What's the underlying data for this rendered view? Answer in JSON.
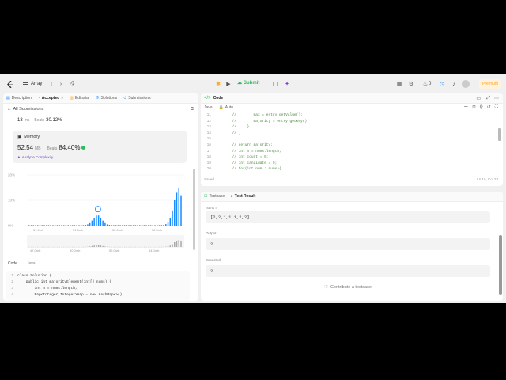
{
  "topbar": {
    "list_label": "Array",
    "submit_label": "Submit",
    "fire_count": "0",
    "premium_label": "Premium"
  },
  "left": {
    "tabs": [
      {
        "label": "Description"
      },
      {
        "label": "Accepted"
      },
      {
        "label": "Editorial"
      },
      {
        "label": "Solutions"
      },
      {
        "label": "Submissions"
      }
    ],
    "all_submissions": "All Submissions",
    "runtime_value": "13",
    "runtime_unit": "ms",
    "runtime_beats_label": "Beats",
    "runtime_beats": "30.12%",
    "memory_title": "Memory",
    "memory_value": "52.54",
    "memory_unit": "MB",
    "memory_beats_label": "Beats",
    "memory_beats": "84.40%",
    "analyze_label": "Analyze Complexity",
    "code_label": "Code",
    "lang_label": "Java",
    "code_lines": [
      {
        "n": "1",
        "t": "class Solution {"
      },
      {
        "n": "2",
        "t": "    public int majorityElement(int[] nums) {"
      },
      {
        "n": "3",
        "t": "        int n = nums.length;"
      },
      {
        "n": "4",
        "t": "        Map<Integer,Integer>map = new HashMap<>();"
      }
    ]
  },
  "chart_data": {
    "type": "bar",
    "ylabels": [
      "20%",
      "10%",
      "0%"
    ],
    "ylim": [
      0,
      20
    ],
    "xlabels": [
      "51.0mb",
      "51.5mb",
      "52.0mb",
      "52.5mb"
    ],
    "mini_xlabels": [
      "47.0mb",
      "50.0mb",
      "52.0mb",
      "54.0mb"
    ],
    "values": [
      0.2,
      0.2,
      0.2,
      0.2,
      0.2,
      0.2,
      0.2,
      0.2,
      0.2,
      0.2,
      0.2,
      0.2,
      0.2,
      0.2,
      0.2,
      0.2,
      0.2,
      0.2,
      0.2,
      0.2,
      0.2,
      0.2,
      0.2,
      0.2,
      0.2,
      0.2,
      0.3,
      0.5,
      1,
      2,
      3,
      4,
      4,
      3,
      2,
      1,
      0.5,
      0.3,
      0.2,
      0.2,
      0.2,
      0.2,
      0.2,
      0.2,
      0.2,
      0.2,
      0.2,
      0.2,
      0.2,
      0.2,
      0.2,
      0.2,
      0.2,
      0.2,
      0.2,
      0.2,
      0.2,
      0.2,
      0.2,
      0.2,
      0.2,
      0.2,
      0.3,
      0.6,
      1.5,
      3,
      6,
      10,
      13,
      15,
      12
    ],
    "accent": "#1a8cff"
  },
  "code": {
    "title": "Code",
    "lang": "Java",
    "mode": "Auto",
    "saved": "Saved",
    "cursor": "Ln 16, Col 23",
    "lines": [
      {
        "n": "11",
        "t": "        //        max = entry.getValue();"
      },
      {
        "n": "12",
        "t": "        //        majority = entry.getKey();"
      },
      {
        "n": "13",
        "t": "        //     }"
      },
      {
        "n": "14",
        "t": "        // }"
      },
      {
        "n": "15",
        "t": ""
      },
      {
        "n": "16",
        "t": "        // return majority;"
      },
      {
        "n": "17",
        "t": "        // int n = nums.length;"
      },
      {
        "n": "18",
        "t": "        // int count = 0;"
      },
      {
        "n": "19",
        "t": "        // int candidate = 0;"
      },
      {
        "n": "20",
        "t": "        // for(int num : nums){"
      }
    ]
  },
  "test": {
    "tab_testcase": "Testcase",
    "tab_result": "Test Result",
    "nums_label": "nums =",
    "nums_value": "[2,2,1,1,1,2,2]",
    "output_label": "Output",
    "output_value": "2",
    "expected_label": "Expected",
    "expected_value": "2",
    "contribute": "Contribute a testcase"
  }
}
